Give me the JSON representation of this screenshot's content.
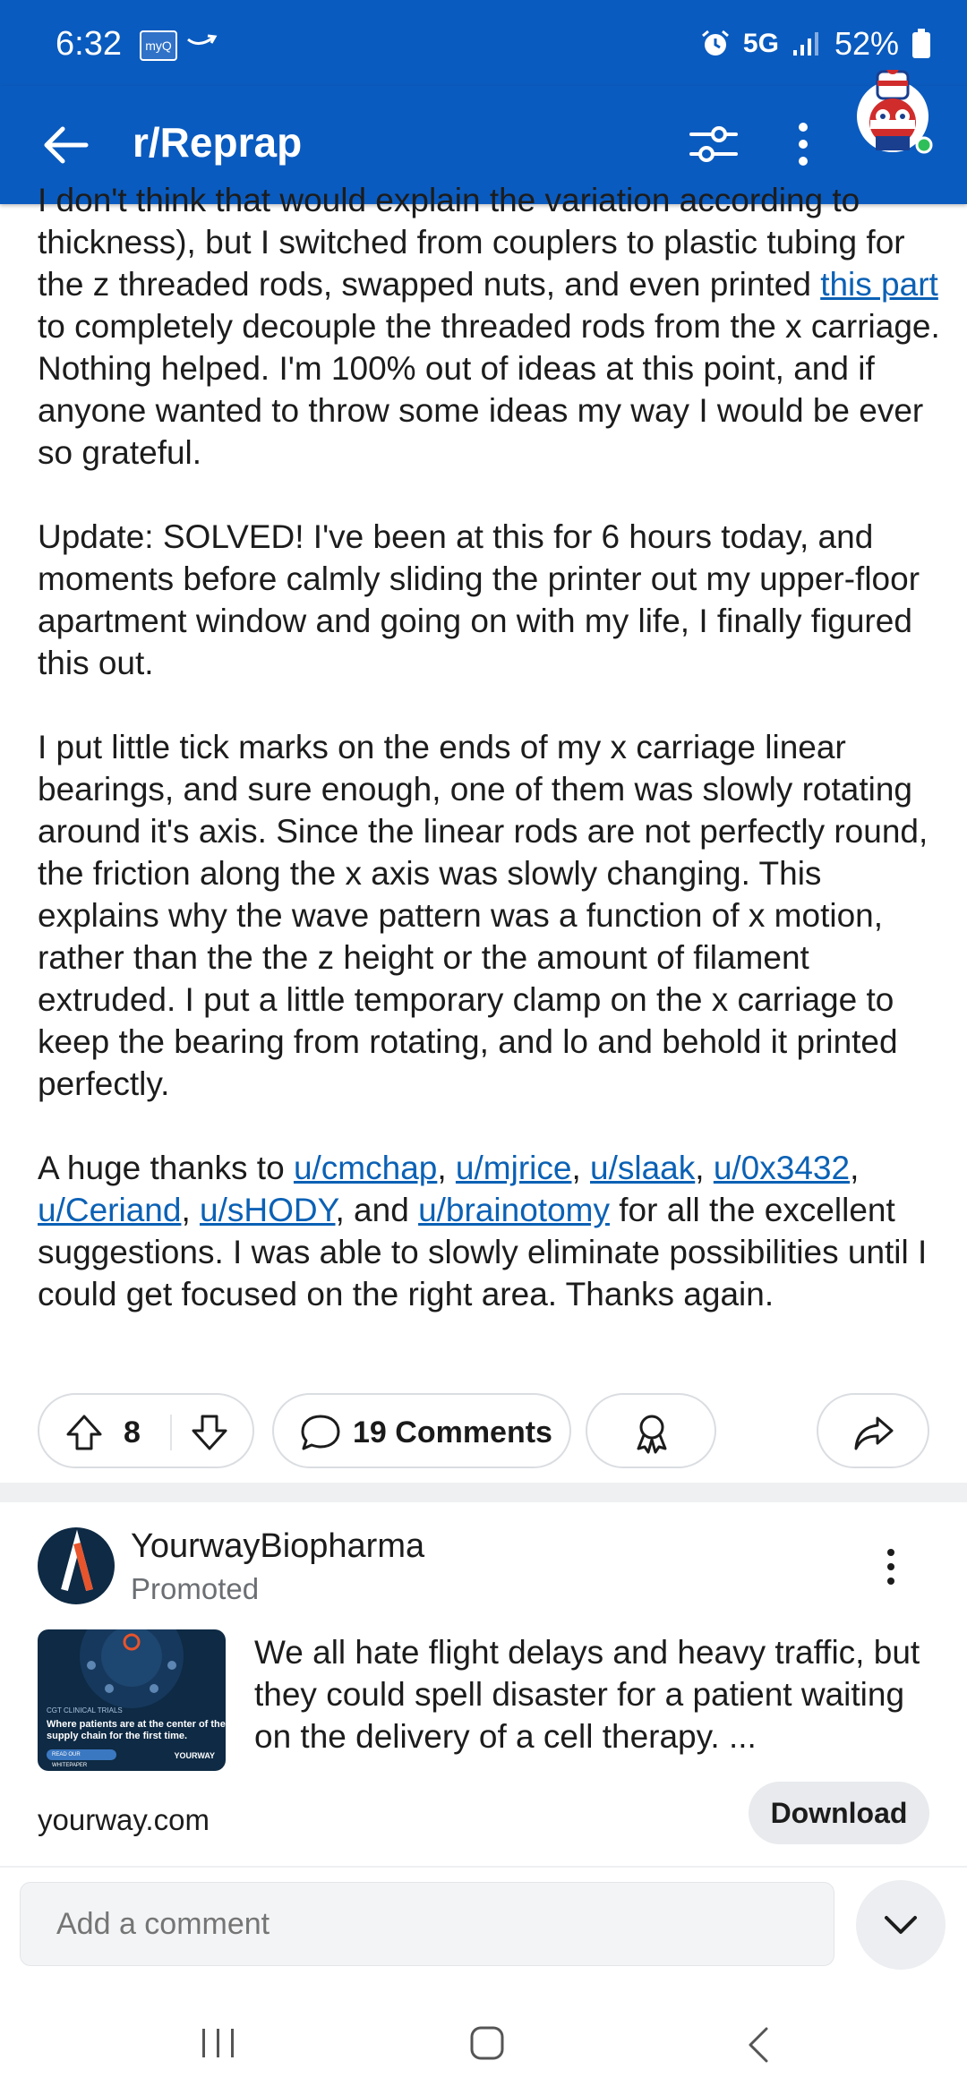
{
  "status_bar": {
    "time": "6:32",
    "myq_label": "myQ",
    "network": "5G",
    "battery": "52%"
  },
  "app_bar": {
    "title": "r/Reprap"
  },
  "post": {
    "p1_text_a": "I don't think that would explain the variation according to thickness), but I switched from couplers to plastic tubing for the z threaded rods, swapped nuts, and even printed ",
    "p1_link": "this part",
    "p1_text_b": " to completely decouple the threaded rods from the x carriage. Nothing helped. I'm 100% out of ideas at this point, and if anyone wanted to throw some ideas my way I would be ever so grateful.",
    "p2": "Update: SOLVED! I've been at this for 6 hours today, and moments before calmly sliding the printer out my upper-floor apartment window and going on with my life, I finally figured this out.",
    "p3": "I put little tick marks on the ends of my x carriage linear bearings, and sure enough, one of them was slowly rotating around it's axis. Since the linear rods are not perfectly round, the friction along the x axis was slowly changing. This explains why the wave pattern was a function of x motion, rather than the the z height or the amount of filament extruded. I put a little temporary clamp on the x carriage to keep the bearing from rotating, and lo and behold it printed perfectly.",
    "p4_intro": "A huge thanks to ",
    "p4_users": [
      "u/cmchap",
      "u/mjrice",
      "u/slaak",
      "u/0x3432",
      "u/Ceriand",
      "u/sHODY",
      "u/brainotomy"
    ],
    "p4_sep_comma": ", ",
    "p4_and": ", and ",
    "p4_outro": " for all the excellent suggestions. I was able to slowly eliminate possibilities until I could get focused on the right area. Thanks again."
  },
  "actions": {
    "vote_count": "8",
    "comments_label": "19 Comments"
  },
  "promoted": {
    "advertiser": "YourwayBiopharma",
    "label": "Promoted",
    "thumb_small": "CGT CLINICAL TRIALS",
    "thumb_title": "Where patients are at the center of the supply chain for the first time.",
    "thumb_button": "READ OUR WHITEPAPER",
    "thumb_brand": "YOURWAY",
    "text": "We all hate flight delays and heavy traffic, but they could spell disaster for a patient waiting on the delivery of a cell therapy. ...",
    "domain": "yourway.com",
    "cta": "Download"
  },
  "comment_box": {
    "placeholder": "Add a comment"
  },
  "colors": {
    "brand_blue": "#0a5bbf",
    "link": "#0b61b5"
  }
}
